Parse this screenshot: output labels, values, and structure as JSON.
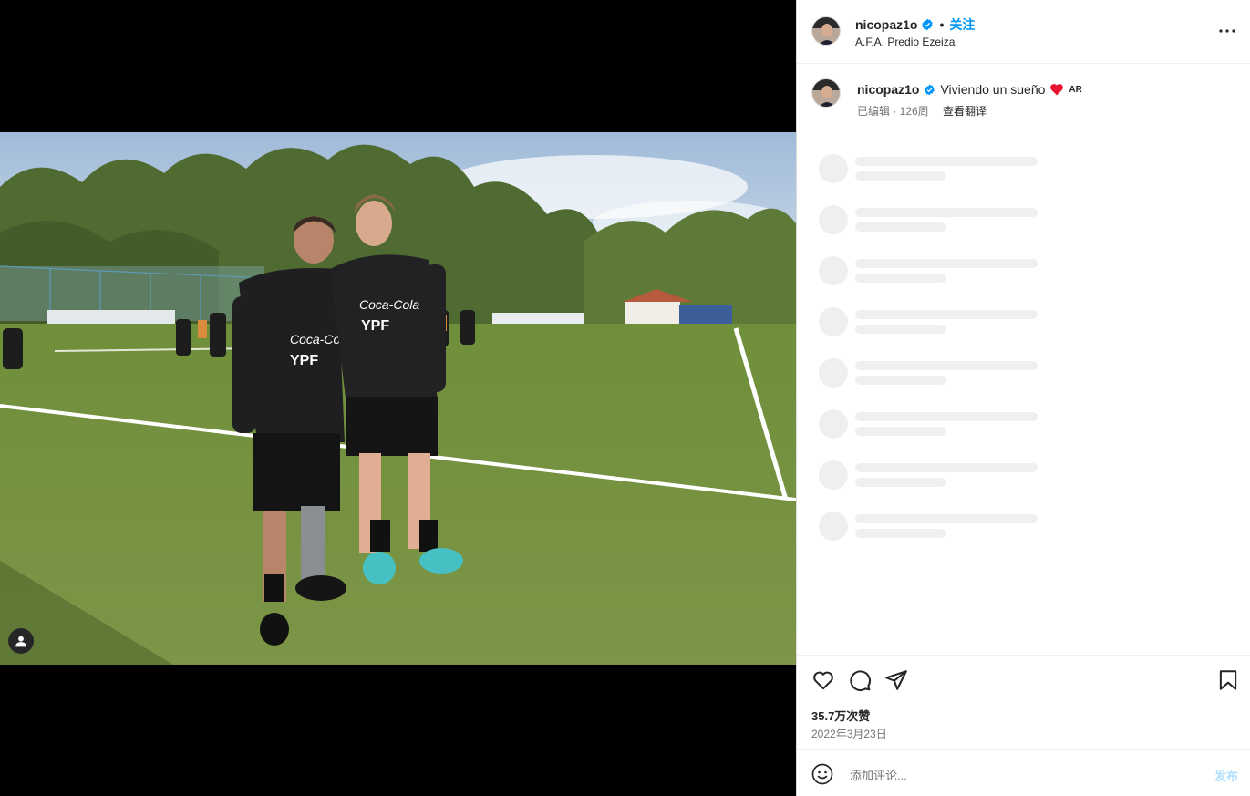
{
  "header": {
    "username": "nicopaz1o",
    "follow_label": "关注",
    "location": "A.F.A. Predio Ezeiza"
  },
  "caption": {
    "username": "nicopaz1o",
    "text": "Viviendo un sueño",
    "flag_text": "AR",
    "edited": "已编辑 · 126周",
    "translate_label": "查看翻译"
  },
  "engagement": {
    "likes": "35.7万次赞",
    "date": "2022年3月23日"
  },
  "comment": {
    "placeholder": "添加评论...",
    "post_label": "发布"
  },
  "colors": {
    "link": "#0095f6",
    "verified": "#0095f6",
    "heart": "#e8132e",
    "skeleton": "#efefef"
  },
  "icons": [
    "verified-badge-icon",
    "more-options-icon",
    "heart-icon",
    "comment-icon",
    "share-icon",
    "bookmark-icon",
    "emoji-icon",
    "user-tag-icon"
  ]
}
